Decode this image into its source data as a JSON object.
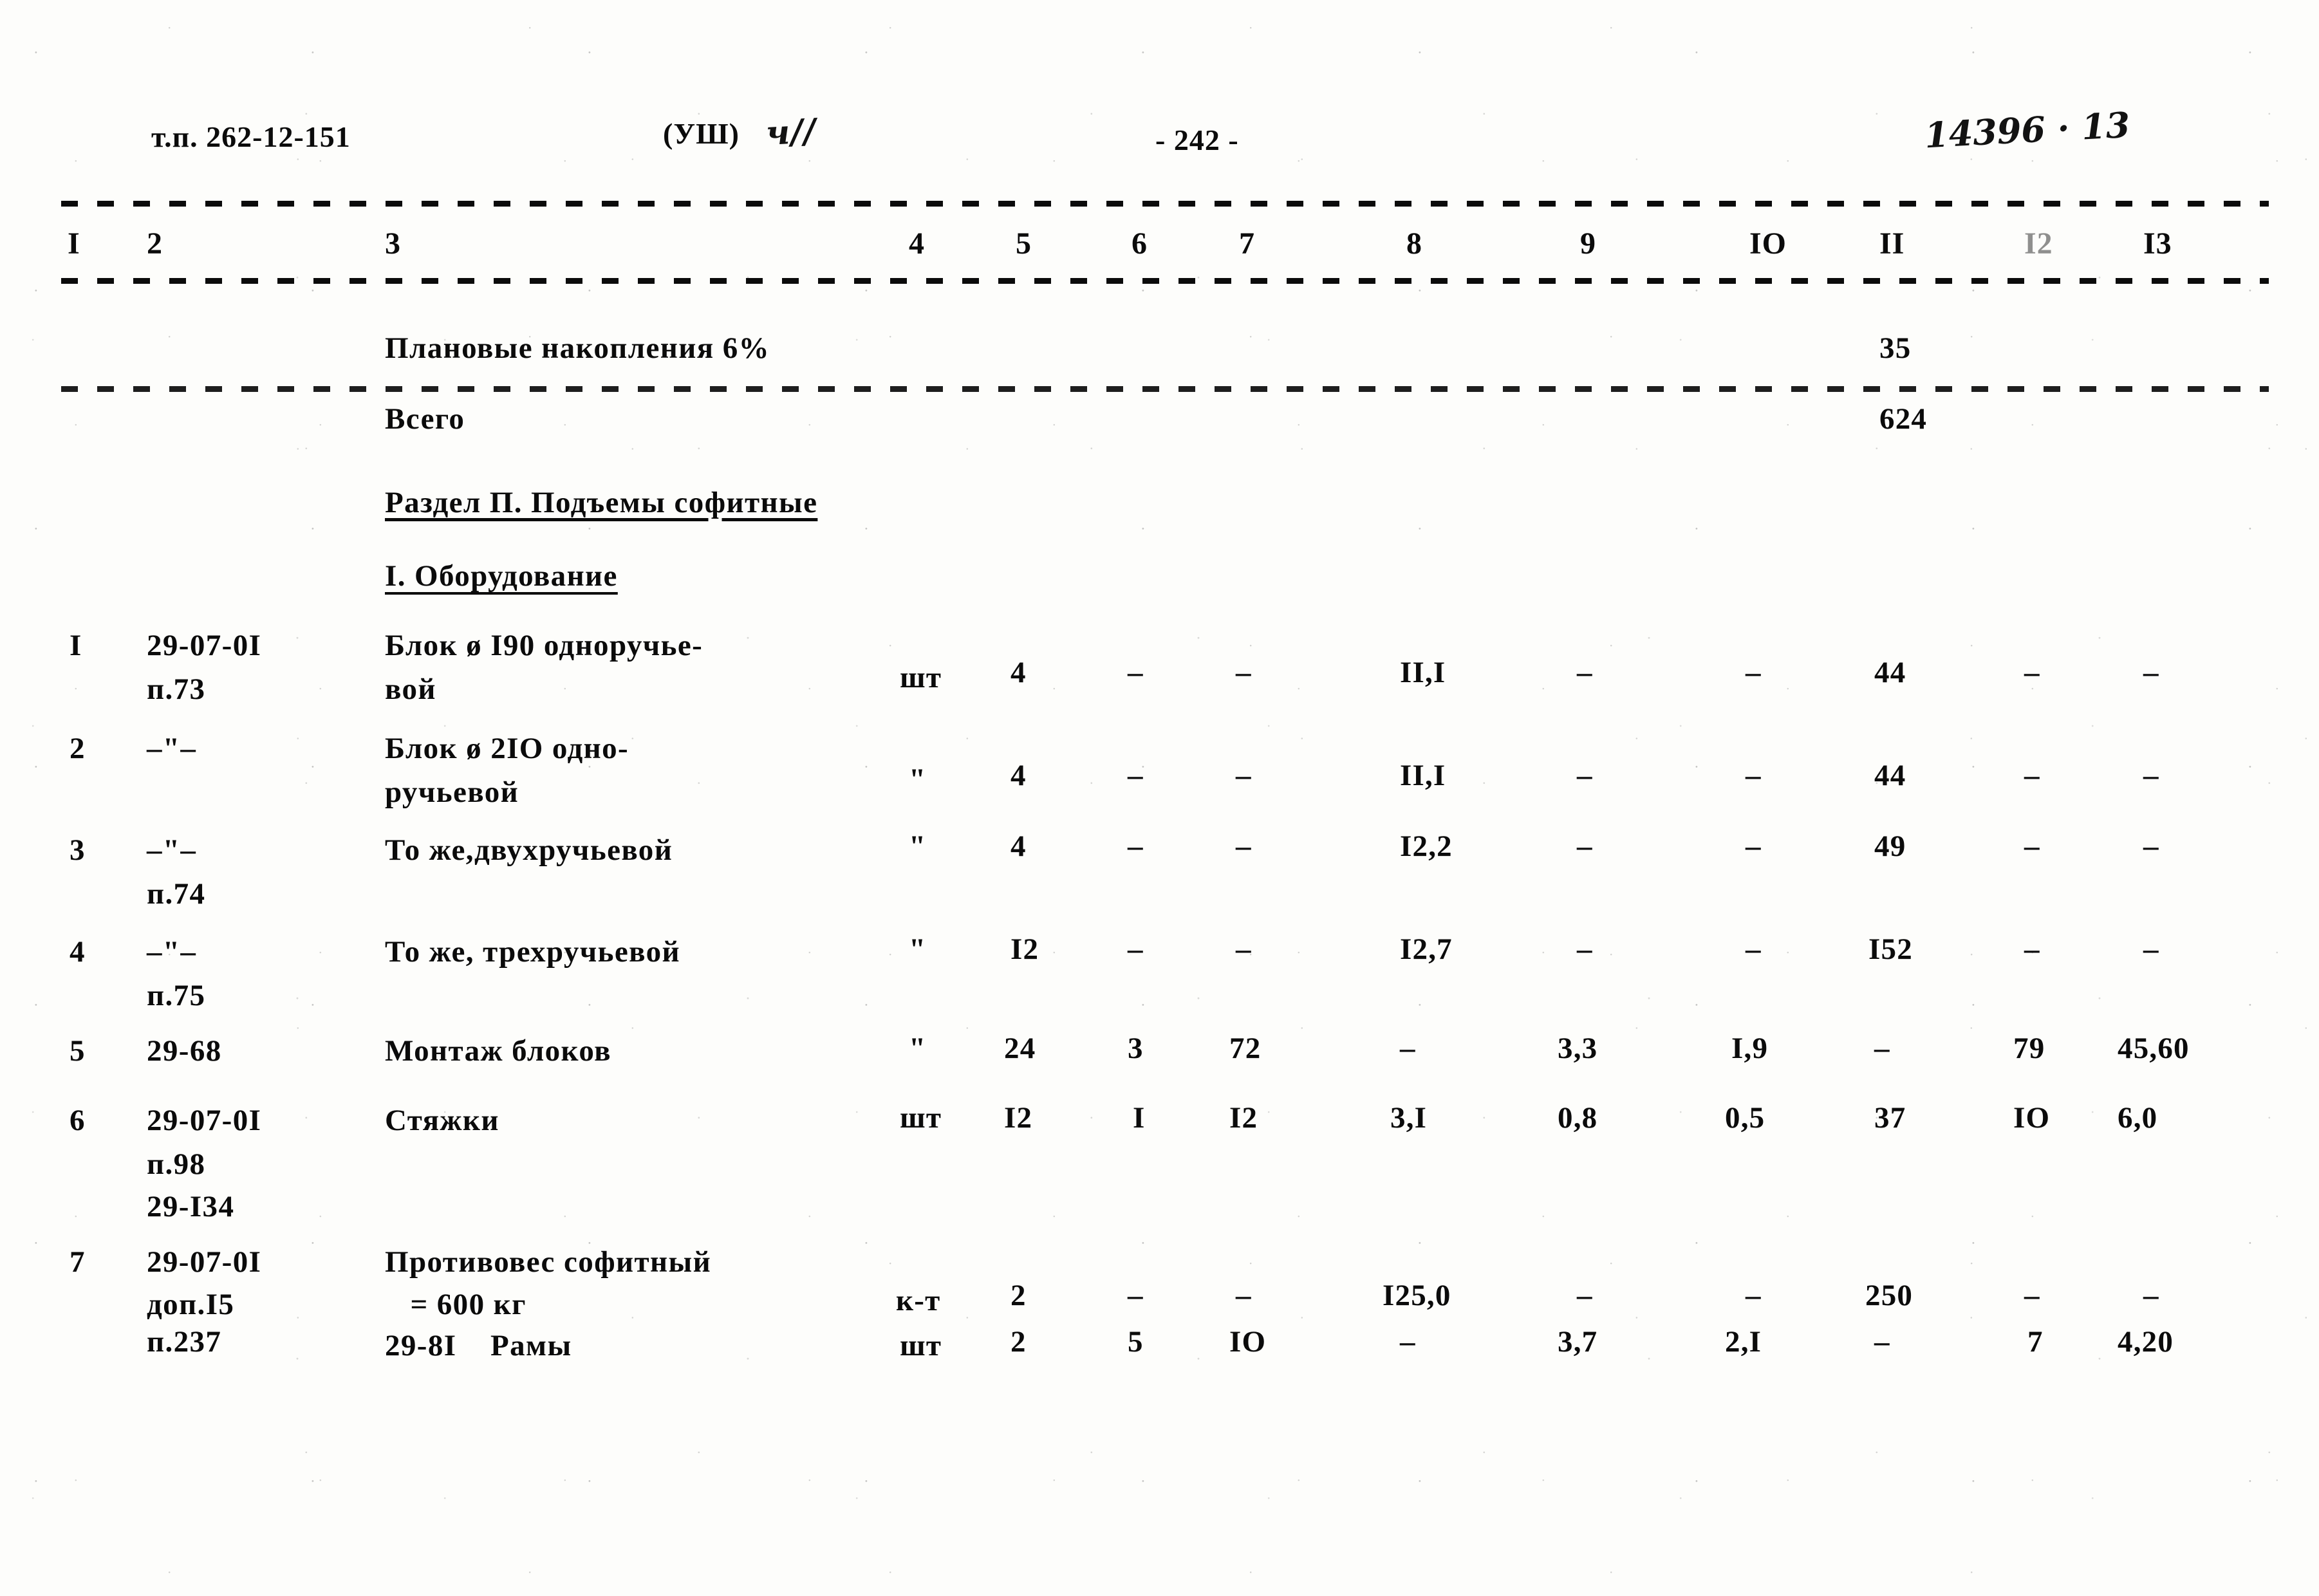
{
  "header": {
    "doc_code": "т.п. 262-12-151",
    "series_marker": "(УШ)",
    "handwritten_series": "ч//",
    "page_number": "- 242 -",
    "handwritten_archive_number": "14396 · 13"
  },
  "column_headers": [
    "I",
    "2",
    "3",
    "4",
    "5",
    "6",
    "7",
    "8",
    "9",
    "IO",
    "II",
    "I2",
    "I3"
  ],
  "summary_rows": [
    {
      "label": "Плановые накопления 6%",
      "col11": "35"
    },
    {
      "label": "Всего",
      "col11": "624"
    }
  ],
  "section": {
    "title": "Раздел П. Подъемы софитные",
    "subtitle": "I. Оборудование"
  },
  "rows": [
    {
      "no": "I",
      "code_lines": [
        "29-07-0I",
        "п.73"
      ],
      "name_lines": [
        "Блок ø I90 одноручье-",
        "вой"
      ],
      "unit": "шт",
      "c5": "4",
      "c6": "–",
      "c7": "–",
      "c8": "II,I",
      "c9": "–",
      "c10": "–",
      "c11": "44",
      "c12": "–",
      "c13": "–"
    },
    {
      "no": "2",
      "code_lines": [
        "–\"–"
      ],
      "name_lines": [
        "Блок ø 2IO одно-",
        "ручьевой"
      ],
      "unit": "\"",
      "c5": "4",
      "c6": "–",
      "c7": "–",
      "c8": "II,I",
      "c9": "–",
      "c10": "–",
      "c11": "44",
      "c12": "–",
      "c13": "–"
    },
    {
      "no": "3",
      "code_lines": [
        "–\"–",
        "п.74"
      ],
      "name_lines": [
        "То же,двухручьевой"
      ],
      "unit": "\"",
      "c5": "4",
      "c6": "–",
      "c7": "–",
      "c8": "I2,2",
      "c9": "–",
      "c10": "–",
      "c11": "49",
      "c12": "–",
      "c13": "–"
    },
    {
      "no": "4",
      "code_lines": [
        "–\"–",
        "п.75"
      ],
      "name_lines": [
        "То же, трехручьевой"
      ],
      "unit": "\"",
      "c5": "I2",
      "c6": "–",
      "c7": "–",
      "c8": "I2,7",
      "c9": "–",
      "c10": "–",
      "c11": "I52",
      "c12": "–",
      "c13": "–"
    },
    {
      "no": "5",
      "code_lines": [
        "29-68"
      ],
      "name_lines": [
        "Монтаж блоков"
      ],
      "unit": "\"",
      "c5": "24",
      "c6": "3",
      "c7": "72",
      "c8": "–",
      "c9": "3,3",
      "c10": "I,9",
      "c11": "–",
      "c12": "79",
      "c13": "45,60"
    },
    {
      "no": "6",
      "code_lines": [
        "29-07-0I",
        "п.98",
        "29-I34"
      ],
      "name_lines": [
        "Стяжки"
      ],
      "unit": "шт",
      "c5": "I2",
      "c6": "I",
      "c7": "I2",
      "c8": "3,I",
      "c9": "0,8",
      "c10": "0,5",
      "c11": "37",
      "c12": "IO",
      "c13": "6,0"
    },
    {
      "no": "7",
      "code_lines": [
        "29-07-0I",
        "доп.I5",
        "п.237"
      ],
      "name_lines": [
        "Противовес софитный",
        "   = 600 кг"
      ],
      "unit": "к-т",
      "c5": "2",
      "c6": "–",
      "c7": "–",
      "c8": "I25,0",
      "c9": "–",
      "c10": "–",
      "c11": "250",
      "c12": "–",
      "c13": "–"
    },
    {
      "no": "",
      "code_lines": [
        "29-8I"
      ],
      "name_lines": [
        "29-8I    Рамы"
      ],
      "unit": "шт",
      "c5": "2",
      "c6": "5",
      "c7": "IO",
      "c8": "–",
      "c9": "3,7",
      "c10": "2,I",
      "c11": "–",
      "c12": "7",
      "c13": "4,20"
    }
  ]
}
